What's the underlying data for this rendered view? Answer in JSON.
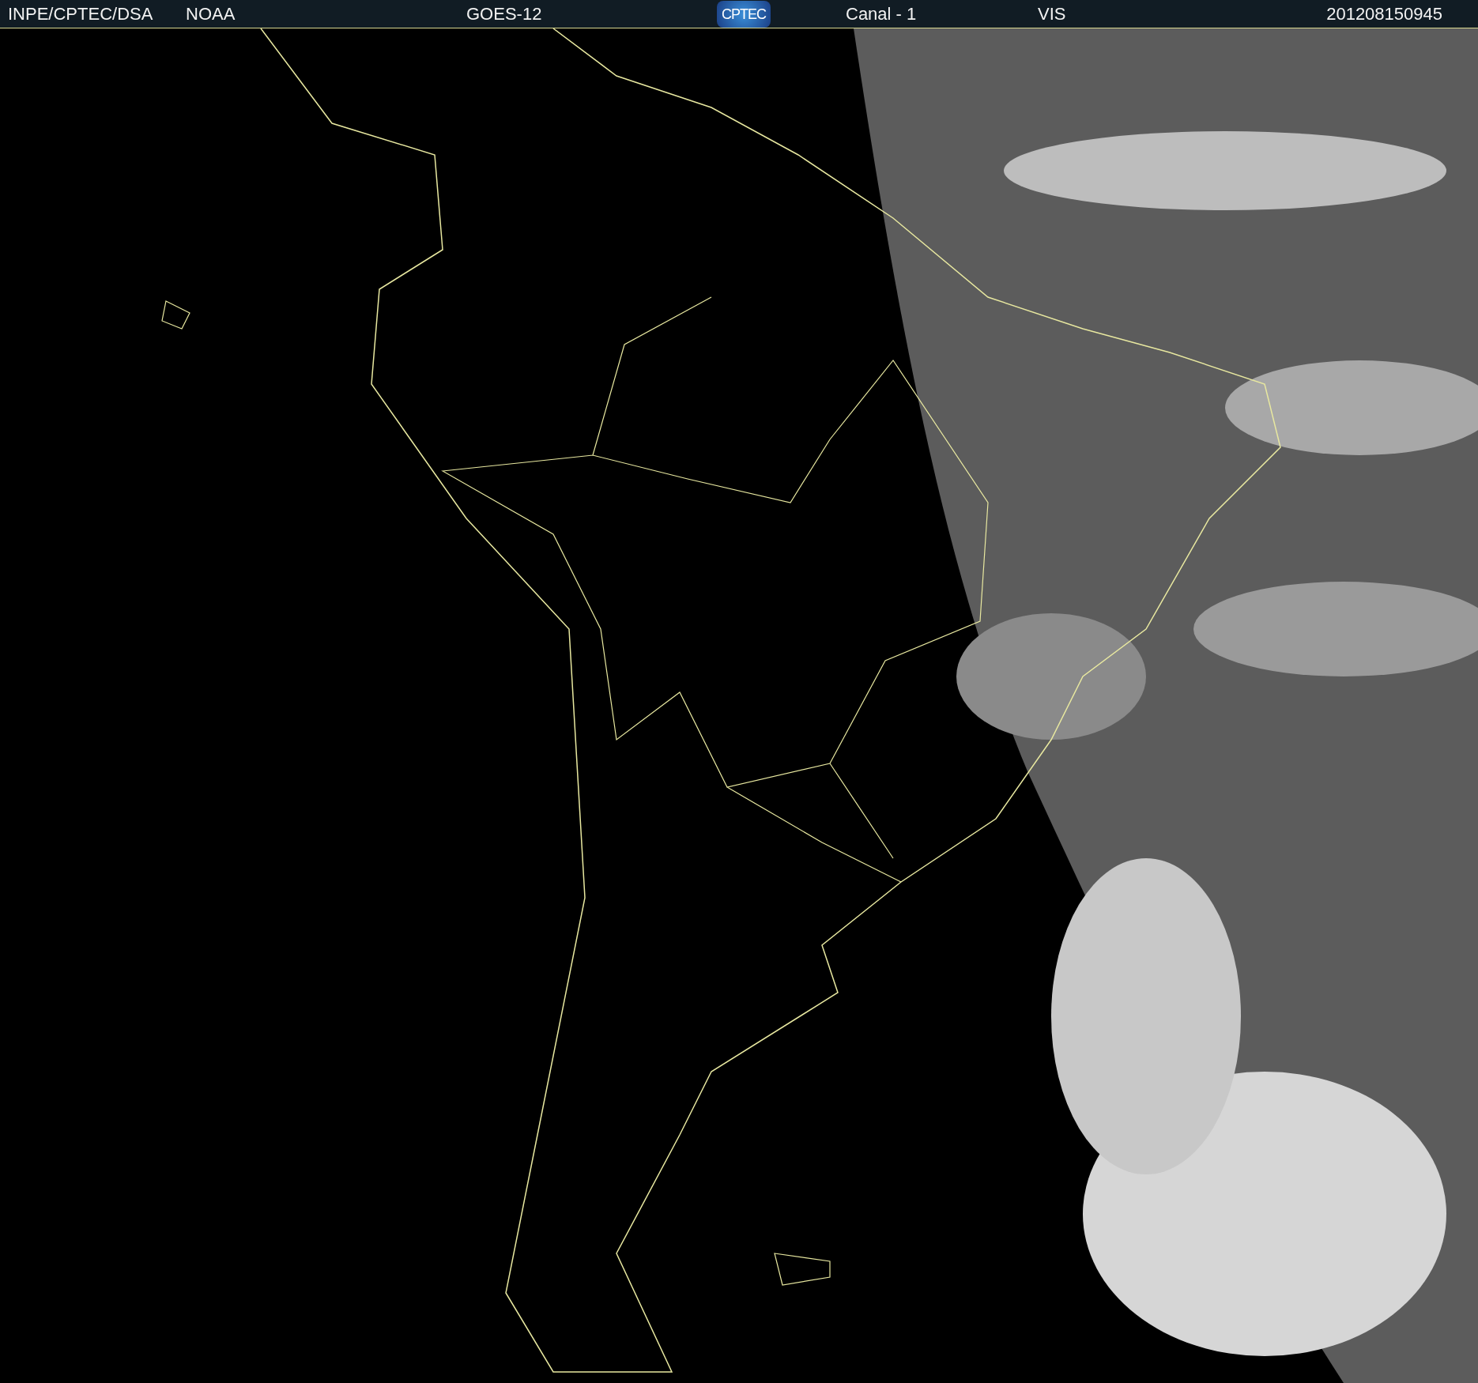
{
  "header": {
    "items": [
      {
        "kind": "text",
        "text": "INPE/CPTEC/DSA"
      },
      {
        "kind": "text",
        "text": "NOAA"
      },
      {
        "kind": "text",
        "text": "GOES-12"
      },
      {
        "kind": "logo",
        "text": "CPTEC"
      },
      {
        "kind": "text",
        "text": "Canal - 1"
      },
      {
        "kind": "text",
        "text": "VIS"
      },
      {
        "kind": "text",
        "text": "201208150945"
      }
    ]
  }
}
